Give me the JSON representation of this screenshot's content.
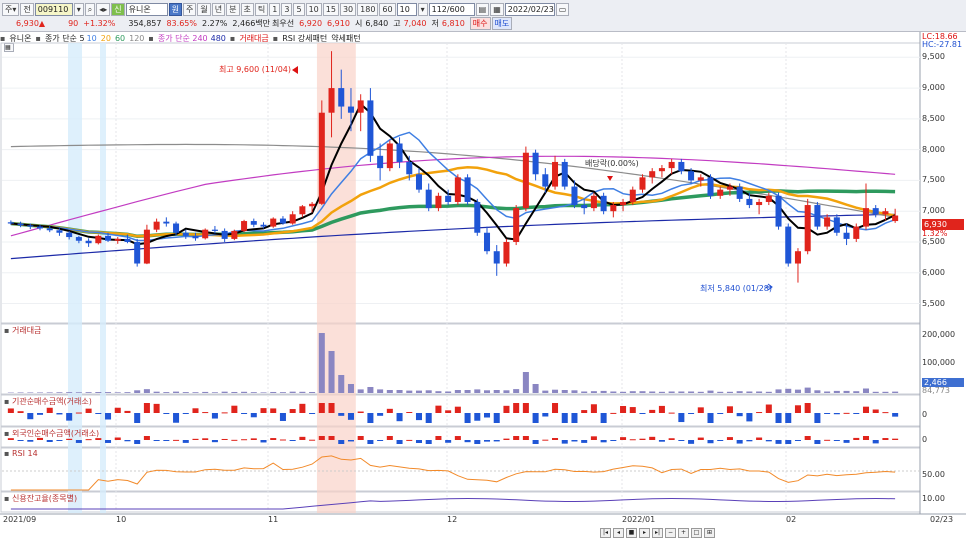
{
  "toolbar": {
    "menu1": "주▾",
    "menu2": "전",
    "code": "009110",
    "stock_name": "유니온",
    "mode": "원",
    "periods": [
      "주",
      "월",
      "년",
      "분",
      "초",
      "틱"
    ],
    "minutes": [
      "1",
      "3",
      "5",
      "10",
      "15",
      "30",
      "180",
      "60"
    ],
    "tick_count": "10",
    "range": "112/600",
    "date": "2022/02/23"
  },
  "quote": {
    "price": "6,930▲",
    "change": "90",
    "change_pct": "+1.32%",
    "volume": "354,857",
    "ratio": "83.65%",
    "turnover_pct": "2.27%",
    "amount": "2,466백만",
    "best_label": "최우선",
    "best_ask": "6,920",
    "best_bid": "6,910",
    "open_label": "시",
    "open": "6,840",
    "high_label": "고",
    "high": "7,040",
    "low_label": "저",
    "low": "6,810",
    "buy_btn": "매수",
    "sell_btn": "매도"
  },
  "legend": {
    "name": "유니온",
    "ma_label": "종가 단순 5",
    "ma10": "10",
    "ma20": "20",
    "ma60": "60",
    "ma120": "120",
    "ma240_label": "종가 단순 240",
    "ma480": "480",
    "vol_label": "거래대금",
    "rsi_label": "RSI 강세패턴",
    "rsi_weak": "약세패턴"
  },
  "right_info": {
    "lc": "LC:18.66",
    "hc": "HC:-27.81"
  },
  "price_axis": [
    "9,500",
    "9,000",
    "8,500",
    "8,000",
    "7,500",
    "7,000",
    "6,500",
    "6,000",
    "5,500"
  ],
  "price_box": {
    "current": "6,930",
    "pct": "1.32%"
  },
  "annotations": {
    "high": "최고 9,600 (11/04)",
    "low": "최저 5,840 (01/28)",
    "dividend": "배당락(0.00%)"
  },
  "panels": {
    "volume": {
      "label": "거래대금",
      "ticks": [
        "200,000",
        "100,000"
      ],
      "box1": "2,466",
      "box2": "84,773"
    },
    "inst": {
      "label": "기관순매수금액(거래소)",
      "tick": "0"
    },
    "foreign": {
      "label": "외국인순매수금액(거래소)",
      "tick": "0"
    },
    "rsi": {
      "label": "RSI 14",
      "tick": "50.00"
    },
    "credit": {
      "label": "신용잔고율(종목별)",
      "tick": "10.00"
    }
  },
  "x_axis": [
    "2021/09",
    "10",
    "11",
    "12",
    "2022/01",
    "02",
    "02/23"
  ],
  "colors": {
    "up": "#e0241c",
    "down": "#1f56d6",
    "ma5": "#000000",
    "ma10": "#3f7fe3",
    "ma20": "#f2a20c",
    "ma60": "#2e9a5e",
    "ma120": "#8c8c8c",
    "ma240": "#c23cc2",
    "ma480": "#1c2aa8"
  },
  "chart_data": {
    "type": "candlestick",
    "candles": [
      [
        6820,
        6850,
        6780,
        6800
      ],
      [
        6800,
        6830,
        6740,
        6770
      ],
      [
        6770,
        6800,
        6710,
        6750
      ],
      [
        6750,
        6780,
        6690,
        6720
      ],
      [
        6720,
        6760,
        6660,
        6690
      ],
      [
        6690,
        6720,
        6600,
        6650
      ],
      [
        6650,
        6680,
        6540,
        6580
      ],
      [
        6580,
        6600,
        6480,
        6520
      ],
      [
        6520,
        6560,
        6420,
        6480
      ],
      [
        6480,
        6620,
        6460,
        6600
      ],
      [
        6600,
        6650,
        6500,
        6520
      ],
      [
        6520,
        6580,
        6470,
        6550
      ],
      [
        6550,
        6620,
        6480,
        6500
      ],
      [
        6500,
        6550,
        6100,
        6150
      ],
      [
        6150,
        6780,
        6140,
        6700
      ],
      [
        6700,
        6880,
        6660,
        6830
      ],
      [
        6830,
        6900,
        6750,
        6800
      ],
      [
        6800,
        6830,
        6600,
        6650
      ],
      [
        6650,
        6700,
        6550,
        6600
      ],
      [
        6600,
        6650,
        6520,
        6560
      ],
      [
        6560,
        6720,
        6540,
        6700
      ],
      [
        6700,
        6760,
        6640,
        6680
      ],
      [
        6680,
        6720,
        6500,
        6550
      ],
      [
        6550,
        6700,
        6530,
        6680
      ],
      [
        6680,
        6860,
        6660,
        6840
      ],
      [
        6840,
        6880,
        6740,
        6780
      ],
      [
        6780,
        6820,
        6720,
        6750
      ],
      [
        6750,
        6900,
        6730,
        6880
      ],
      [
        6880,
        6920,
        6780,
        6800
      ],
      [
        6800,
        7000,
        6780,
        6950
      ],
      [
        6950,
        7100,
        6900,
        7080
      ],
      [
        7080,
        7150,
        6980,
        7120
      ],
      [
        7120,
        8800,
        7100,
        8600
      ],
      [
        8600,
        9600,
        8200,
        9000
      ],
      [
        9000,
        9300,
        8500,
        8700
      ],
      [
        8700,
        9000,
        8300,
        8600
      ],
      [
        8600,
        8900,
        8300,
        8800
      ],
      [
        8800,
        9000,
        7800,
        7900
      ],
      [
        7900,
        8100,
        7500,
        7700
      ],
      [
        7700,
        8150,
        7650,
        8100
      ],
      [
        8100,
        8200,
        7700,
        7800
      ],
      [
        7800,
        7900,
        7500,
        7600
      ],
      [
        7600,
        7700,
        7300,
        7350
      ],
      [
        7350,
        7450,
        7000,
        7050
      ],
      [
        7050,
        7300,
        7000,
        7250
      ],
      [
        7250,
        7350,
        7100,
        7150
      ],
      [
        7150,
        7600,
        7100,
        7550
      ],
      [
        7550,
        7600,
        7100,
        7150
      ],
      [
        7150,
        7200,
        6600,
        6650
      ],
      [
        6650,
        6750,
        6300,
        6350
      ],
      [
        6350,
        6450,
        5950,
        6150
      ],
      [
        6150,
        6550,
        6100,
        6500
      ],
      [
        6500,
        7100,
        6450,
        7050
      ],
      [
        7050,
        8050,
        7000,
        7950
      ],
      [
        7950,
        8000,
        7500,
        7600
      ],
      [
        7600,
        7700,
        7300,
        7400
      ],
      [
        7400,
        7900,
        7350,
        7800
      ],
      [
        7800,
        7850,
        7350,
        7400
      ],
      [
        7400,
        7500,
        7050,
        7100
      ],
      [
        7100,
        7200,
        6950,
        7050
      ],
      [
        7050,
        7300,
        7000,
        7250
      ],
      [
        7250,
        7300,
        6950,
        7000
      ],
      [
        7000,
        7150,
        6900,
        7100
      ],
      [
        7100,
        7200,
        7000,
        7150
      ],
      [
        7150,
        7400,
        7100,
        7350
      ],
      [
        7350,
        7600,
        7300,
        7550
      ],
      [
        7550,
        7700,
        7450,
        7650
      ],
      [
        7650,
        7750,
        7550,
        7700
      ],
      [
        7700,
        7850,
        7600,
        7800
      ],
      [
        7800,
        7850,
        7600,
        7650
      ],
      [
        7650,
        7700,
        7450,
        7500
      ],
      [
        7500,
        7600,
        7400,
        7550
      ],
      [
        7550,
        7600,
        7200,
        7250
      ],
      [
        7250,
        7400,
        7200,
        7350
      ],
      [
        7350,
        7450,
        7250,
        7400
      ],
      [
        7400,
        7450,
        7150,
        7200
      ],
      [
        7200,
        7300,
        7050,
        7100
      ],
      [
        7100,
        7200,
        6950,
        7150
      ],
      [
        7150,
        7300,
        7100,
        7250
      ],
      [
        7250,
        7300,
        6700,
        6750
      ],
      [
        6750,
        6800,
        6100,
        6150
      ],
      [
        6150,
        6400,
        5840,
        6350
      ],
      [
        6350,
        7200,
        6300,
        7100
      ],
      [
        7100,
        7150,
        6700,
        6750
      ],
      [
        6750,
        6950,
        6700,
        6900
      ],
      [
        6900,
        6950,
        6600,
        6650
      ],
      [
        6650,
        6800,
        6450,
        6550
      ],
      [
        6550,
        6800,
        6500,
        6750
      ],
      [
        6750,
        7450,
        6700,
        7050
      ],
      [
        7050,
        7100,
        6900,
        6950
      ],
      [
        6950,
        7050,
        6850,
        7000
      ],
      [
        6840,
        7040,
        6810,
        6930
      ]
    ]
  }
}
